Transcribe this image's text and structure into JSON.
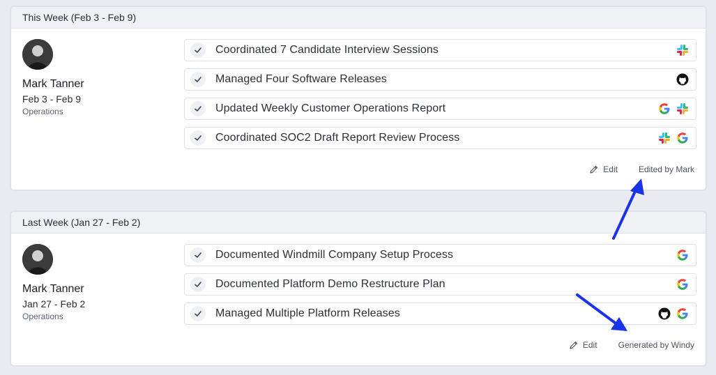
{
  "weeks": [
    {
      "title": "This Week (Feb 3 - Feb 9)",
      "person": {
        "name": "Mark Tanner",
        "dates": "Feb 3 - Feb 9",
        "department": "Operations"
      },
      "items": [
        {
          "text": "Coordinated 7 Candidate Interview Sessions",
          "icons": [
            "slack-icon"
          ]
        },
        {
          "text": "Managed Four Software Releases",
          "icons": [
            "github-icon"
          ]
        },
        {
          "text": "Updated Weekly Customer Operations Report",
          "icons": [
            "google-icon",
            "slack-icon"
          ]
        },
        {
          "text": "Coordinated SOC2 Draft Report Review Process",
          "icons": [
            "slack-icon",
            "google-icon"
          ]
        }
      ],
      "edit_label": "Edit",
      "attribution": "Edited by Mark"
    },
    {
      "title": "Last Week (Jan 27 - Feb 2)",
      "person": {
        "name": "Mark Tanner",
        "dates": "Jan 27 - Feb 2",
        "department": "Operations"
      },
      "items": [
        {
          "text": "Documented Windmill Company Setup Process",
          "icons": [
            "google-icon"
          ]
        },
        {
          "text": "Documented Platform Demo Restructure Plan",
          "icons": [
            "google-icon"
          ]
        },
        {
          "text": "Managed Multiple Platform Releases",
          "icons": [
            "github-icon",
            "google-icon"
          ]
        }
      ],
      "edit_label": "Edit",
      "attribution": "Generated by Windy"
    }
  ],
  "colors": {
    "annotation_arrow": "#1a33e6",
    "check": "#3a4150"
  }
}
